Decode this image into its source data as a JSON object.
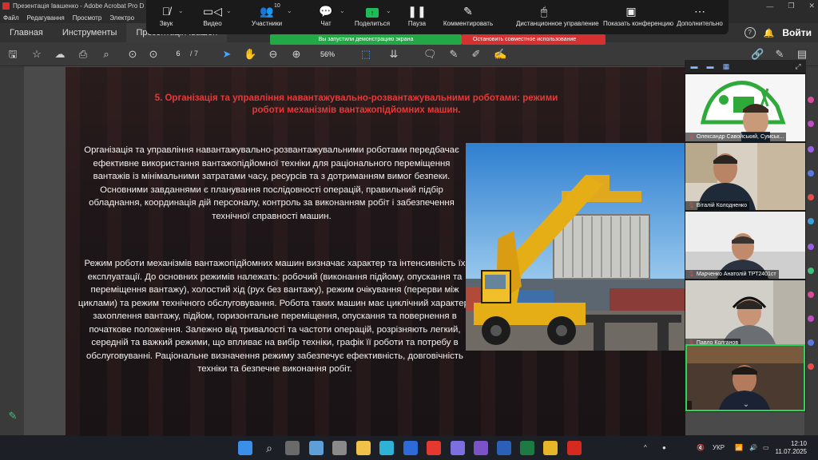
{
  "window": {
    "title": "Презентація Івашенко - Adobe Acrobat Pro D",
    "menu": [
      "Файл",
      "Редагування",
      "Просмотр",
      "Электро"
    ]
  },
  "tabs": [
    {
      "label": "Главная"
    },
    {
      "label": "Инструменты"
    },
    {
      "label": "Презентація Івашен"
    }
  ],
  "account": {
    "signin": "Войти"
  },
  "toolbar": {
    "page_current": "6",
    "page_total": "/ 7",
    "zoom": "56%"
  },
  "zoom_controls": {
    "items": [
      {
        "label": "Звук",
        "icon": "mic-muted-icon"
      },
      {
        "label": "Видео",
        "icon": "camera-icon"
      },
      {
        "label": "Участники",
        "icon": "participants-icon",
        "count": "10"
      },
      {
        "label": "Чат",
        "icon": "chat-icon"
      },
      {
        "label": "Поделиться",
        "icon": "share-screen-icon"
      },
      {
        "label": "Пауза",
        "icon": "pause-icon"
      },
      {
        "label": "Комментировать",
        "icon": "annotate-icon"
      },
      {
        "label": "Дистанционное управление",
        "icon": "remote-control-icon"
      },
      {
        "label": "Показать конференцию",
        "icon": "show-meeting-icon"
      },
      {
        "label": "Дополнительно",
        "icon": "more-icon"
      }
    ],
    "share_banner": "Вы запустили демонстрацию экрана",
    "stop_share": "Остановить совместное использование"
  },
  "slide": {
    "title": "5. Організація та управління навантажувально-розвантажувальними роботами: режими роботи механізмів вантажопідйомних машин.",
    "paragraph1": "Організація та управління навантажувально-розвантажувальними роботами передбачає ефективне використання вантажопідйомної техніки для раціонального переміщення вантажів із мінімальними затратами часу, ресурсів та з дотриманням вимог безпеки. Основними завданнями є планування послідовності операцій, правильний підбір обладнання, координація дій персоналу, контроль за виконанням робіт і забезпечення технічної справності машин.",
    "paragraph2": "Режим роботи механізмів вантажопідйомних машин визначає характер та інтенсивність їх експлуатації. До основних режимів належать: робочий (виконання підйому, опускання та переміщення вантажу), холостий хід (рух без вантажу), режим очікування (перерви між циклами) та режим технічного обслуговування. Робота таких машин має циклічний характер: захоплення вантажу, підйом, горизонтальне переміщення, опускання та повернення в початкове положення. Залежно від тривалості та частоти операцій, розрізняють легкий, середній та важкий режими, що впливає на вибір техніки, графік її роботи та потребу в обслуговуванні. Раціональне визначення режиму забезпечує ефективність, довговічність техніки та безпечне виконання робіт."
  },
  "participants": [
    {
      "name": "Олександр Савойський, Сумськ..."
    },
    {
      "name": "Віталій Колодненко"
    },
    {
      "name": "Марченко Анатолій ТРТ2401ст"
    },
    {
      "name": "Павло Колганов"
    },
    {
      "name": ""
    }
  ],
  "taskbar": {
    "language": "УКР",
    "time": "12:10",
    "date": "11.07.2025"
  },
  "colors": {
    "accent_red": "#e33a3a",
    "share_green": "#22a845",
    "stop_red": "#d63030"
  }
}
